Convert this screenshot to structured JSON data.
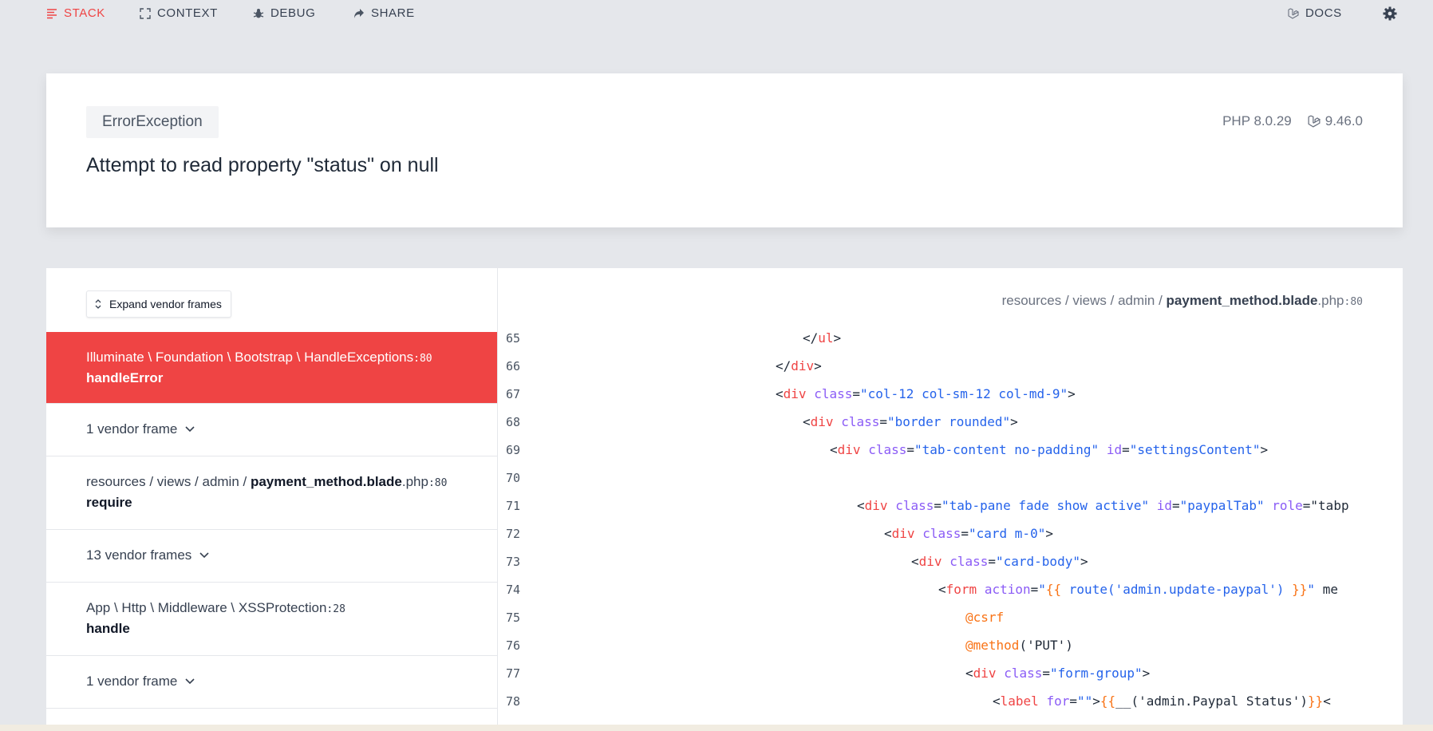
{
  "nav": {
    "items": [
      {
        "label": "STACK",
        "icon": "stack-icon",
        "active": true
      },
      {
        "label": "CONTEXT",
        "icon": "expand-icon",
        "active": false
      },
      {
        "label": "DEBUG",
        "icon": "bug-icon",
        "active": false
      },
      {
        "label": "SHARE",
        "icon": "share-icon",
        "active": false
      }
    ],
    "docs_label": "DOCS",
    "settings_icon": "gear-icon"
  },
  "error": {
    "type": "ErrorException",
    "message": "Attempt to read property \"status\" on null",
    "php_version": "PHP 8.0.29",
    "laravel_version": "9.46.0"
  },
  "stack": {
    "expand_label": "Expand vendor frames",
    "frames": [
      {
        "kind": "frame",
        "class_path": "Illuminate \\ Foundation \\ Bootstrap \\ HandleExceptions",
        "line": ":80",
        "method": "handleError",
        "selected": true
      },
      {
        "kind": "vendor",
        "label": "1 vendor frame"
      },
      {
        "kind": "frame",
        "path_prefix": "resources / views / admin / ",
        "file": "payment_method.blade",
        "ext": ".php",
        "line": ":80",
        "method": "require",
        "selected": false
      },
      {
        "kind": "vendor",
        "label": "13 vendor frames"
      },
      {
        "kind": "frame",
        "class_path": "App \\ Http \\ Middleware \\ XSSProtection",
        "line": ":28",
        "method": "handle",
        "selected": false
      },
      {
        "kind": "vendor",
        "label": "1 vendor frame"
      }
    ]
  },
  "code": {
    "file_prefix": "resources / views / admin / ",
    "file_name": "payment_method.blade",
    "file_ext": ".php",
    "file_line": ":80",
    "lines": [
      {
        "num": "65",
        "text": "</ul>"
      },
      {
        "num": "66",
        "text": "</div>"
      },
      {
        "num": "67",
        "text": "<div class=\"col-12 col-sm-12 col-md-9\">"
      },
      {
        "num": "68",
        "text": "<div class=\"border rounded\">"
      },
      {
        "num": "69",
        "text": "<div class=\"tab-content no-padding\" id=\"settingsContent\">"
      },
      {
        "num": "70",
        "text": ""
      },
      {
        "num": "71",
        "text": "<div class=\"tab-pane fade show active\" id=\"paypalTab\" role=\"tabp"
      },
      {
        "num": "72",
        "text": "<div class=\"card m-0\">"
      },
      {
        "num": "73",
        "text": "<div class=\"card-body\">"
      },
      {
        "num": "74",
        "text": "<form action=\"{{ route('admin.update-paypal') }}\" me"
      },
      {
        "num": "75",
        "text": "@csrf"
      },
      {
        "num": "76",
        "text": "@method('PUT')"
      },
      {
        "num": "77",
        "text": "<div class=\"form-group\">"
      },
      {
        "num": "78",
        "text": "<label for=\"\">{{__('admin.Paypal Status')}}<"
      }
    ]
  }
}
